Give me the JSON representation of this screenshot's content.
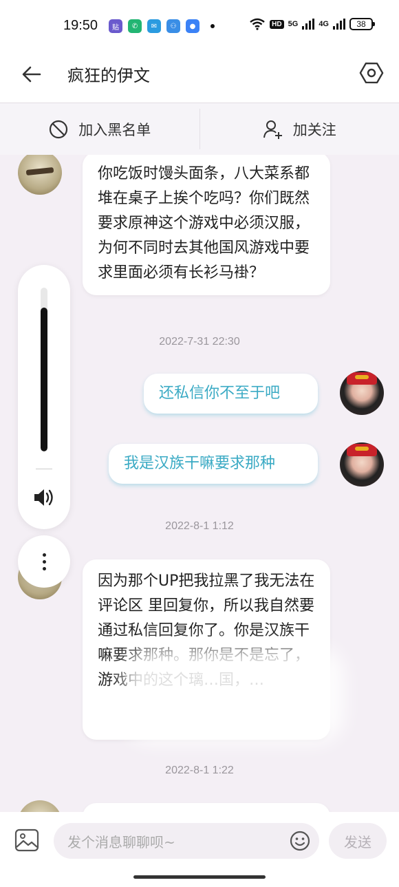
{
  "status": {
    "time": "19:50",
    "signal_5g": "5G",
    "signal_4g": "4G",
    "hd": "HD",
    "battery": "38"
  },
  "header": {
    "title": "疯狂的伊文"
  },
  "actions": {
    "block": "加入黑名单",
    "follow": "加关注"
  },
  "messages": {
    "m1": "你吃饭时馒头面条，八大菜系都堆在桌子上挨个吃吗？你们既然要求原神这个游戏中必须汉服，为何不同时去其他国风游戏中要求里面必须有长衫马褂？",
    "ts1": "2022-7-31 22:30",
    "m2": "还私信你不至于吧",
    "m3": "我是汉族干嘛要求那种",
    "ts2": "2022-8-1 1:12",
    "m4": "因为那个UP把我拉黑了我无法在评论区 里回复你，所以我自然要通过私信回复你了。你是汉族干嘛要求那种。那你是不是忘了，游戏中的这个璃…国，…",
    "ts3": "2022-8-1 1:22"
  },
  "volume": {
    "level": 0.88
  },
  "input": {
    "placeholder": "发个消息聊聊呗~",
    "send": "发送"
  }
}
